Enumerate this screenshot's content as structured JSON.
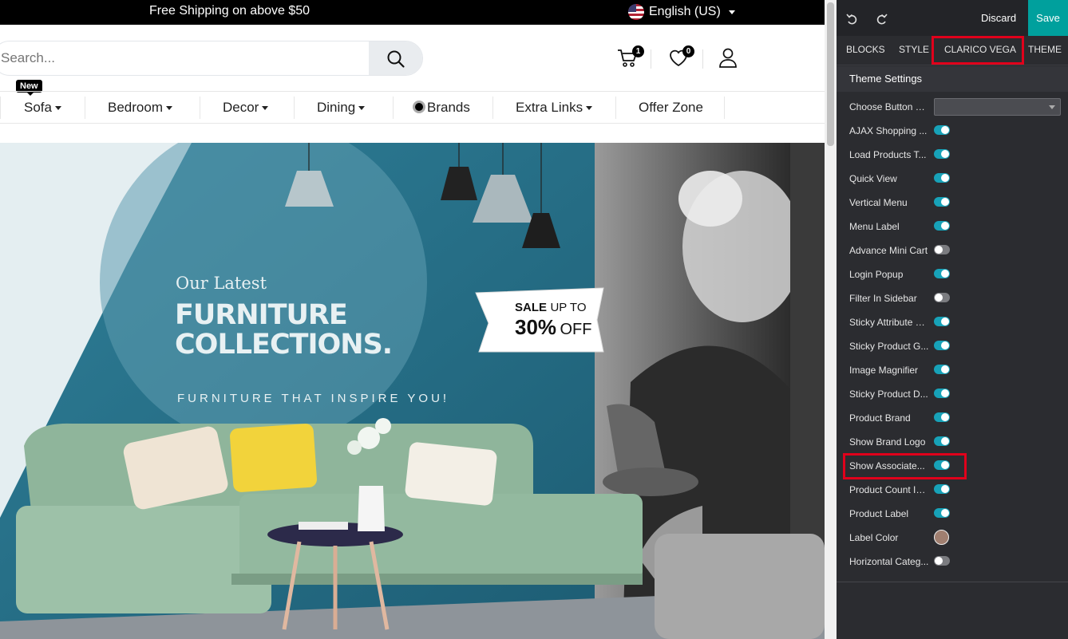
{
  "site": {
    "topbar": {
      "shipping": "Free Shipping on above $50",
      "language": "English (US)"
    },
    "search": {
      "placeholder": "Search..."
    },
    "cart_count": "1",
    "wishlist_count": "0",
    "new_tag": "New",
    "nav": [
      "Sofa",
      "Bedroom",
      "Decor",
      "Dining",
      "Brands",
      "Extra Links",
      "Offer Zone"
    ],
    "banner": {
      "kicker": "Our Latest",
      "title_line1": "FURNITURE",
      "title_line2": "COLLECTIONS.",
      "tagline": "FURNITURE THAT INSPIRE YOU!",
      "sale_word": "SALE",
      "sale_upto": "UP TO",
      "sale_pct": "30%",
      "sale_off": "OFF"
    }
  },
  "panel": {
    "discard_label": "Discard",
    "save_label": "Save",
    "tabs": [
      "BLOCKS",
      "STYLE",
      "CLARICO VEGA",
      "THEME"
    ],
    "active_tab": "CLARICO VEGA",
    "section_title": "Theme Settings",
    "accent_color": "#17a2b8",
    "save_color": "#00a09d",
    "options": [
      {
        "label": "Choose Button S...",
        "type": "select",
        "value": ""
      },
      {
        "label": "AJAX Shopping ...",
        "type": "toggle",
        "on": true
      },
      {
        "label": "Load Products T...",
        "type": "toggle",
        "on": true
      },
      {
        "label": "Quick View",
        "type": "toggle",
        "on": true
      },
      {
        "label": "Vertical Menu",
        "type": "toggle",
        "on": true
      },
      {
        "label": "Menu Label",
        "type": "toggle",
        "on": true
      },
      {
        "label": "Advance Mini Cart",
        "type": "toggle",
        "on": false
      },
      {
        "label": "Login Popup",
        "type": "toggle",
        "on": true
      },
      {
        "label": "Filter In Sidebar",
        "type": "toggle",
        "on": false
      },
      {
        "label": "Sticky Attribute &...",
        "type": "toggle",
        "on": true
      },
      {
        "label": "Sticky Product G...",
        "type": "toggle",
        "on": true
      },
      {
        "label": "Image Magnifier",
        "type": "toggle",
        "on": true
      },
      {
        "label": "Sticky Product D...",
        "type": "toggle",
        "on": true
      },
      {
        "label": "Product Brand",
        "type": "toggle",
        "on": true
      },
      {
        "label": "Show Brand Logo",
        "type": "toggle",
        "on": true
      },
      {
        "label": "Show Associate...",
        "type": "toggle",
        "on": true
      },
      {
        "label": "Product Count In...",
        "type": "toggle",
        "on": true
      },
      {
        "label": "Product Label",
        "type": "toggle",
        "on": true
      },
      {
        "label": "Label Color",
        "type": "color",
        "value": "#a07f70"
      },
      {
        "label": "Horizontal Categ...",
        "type": "toggle",
        "on": false
      }
    ]
  }
}
